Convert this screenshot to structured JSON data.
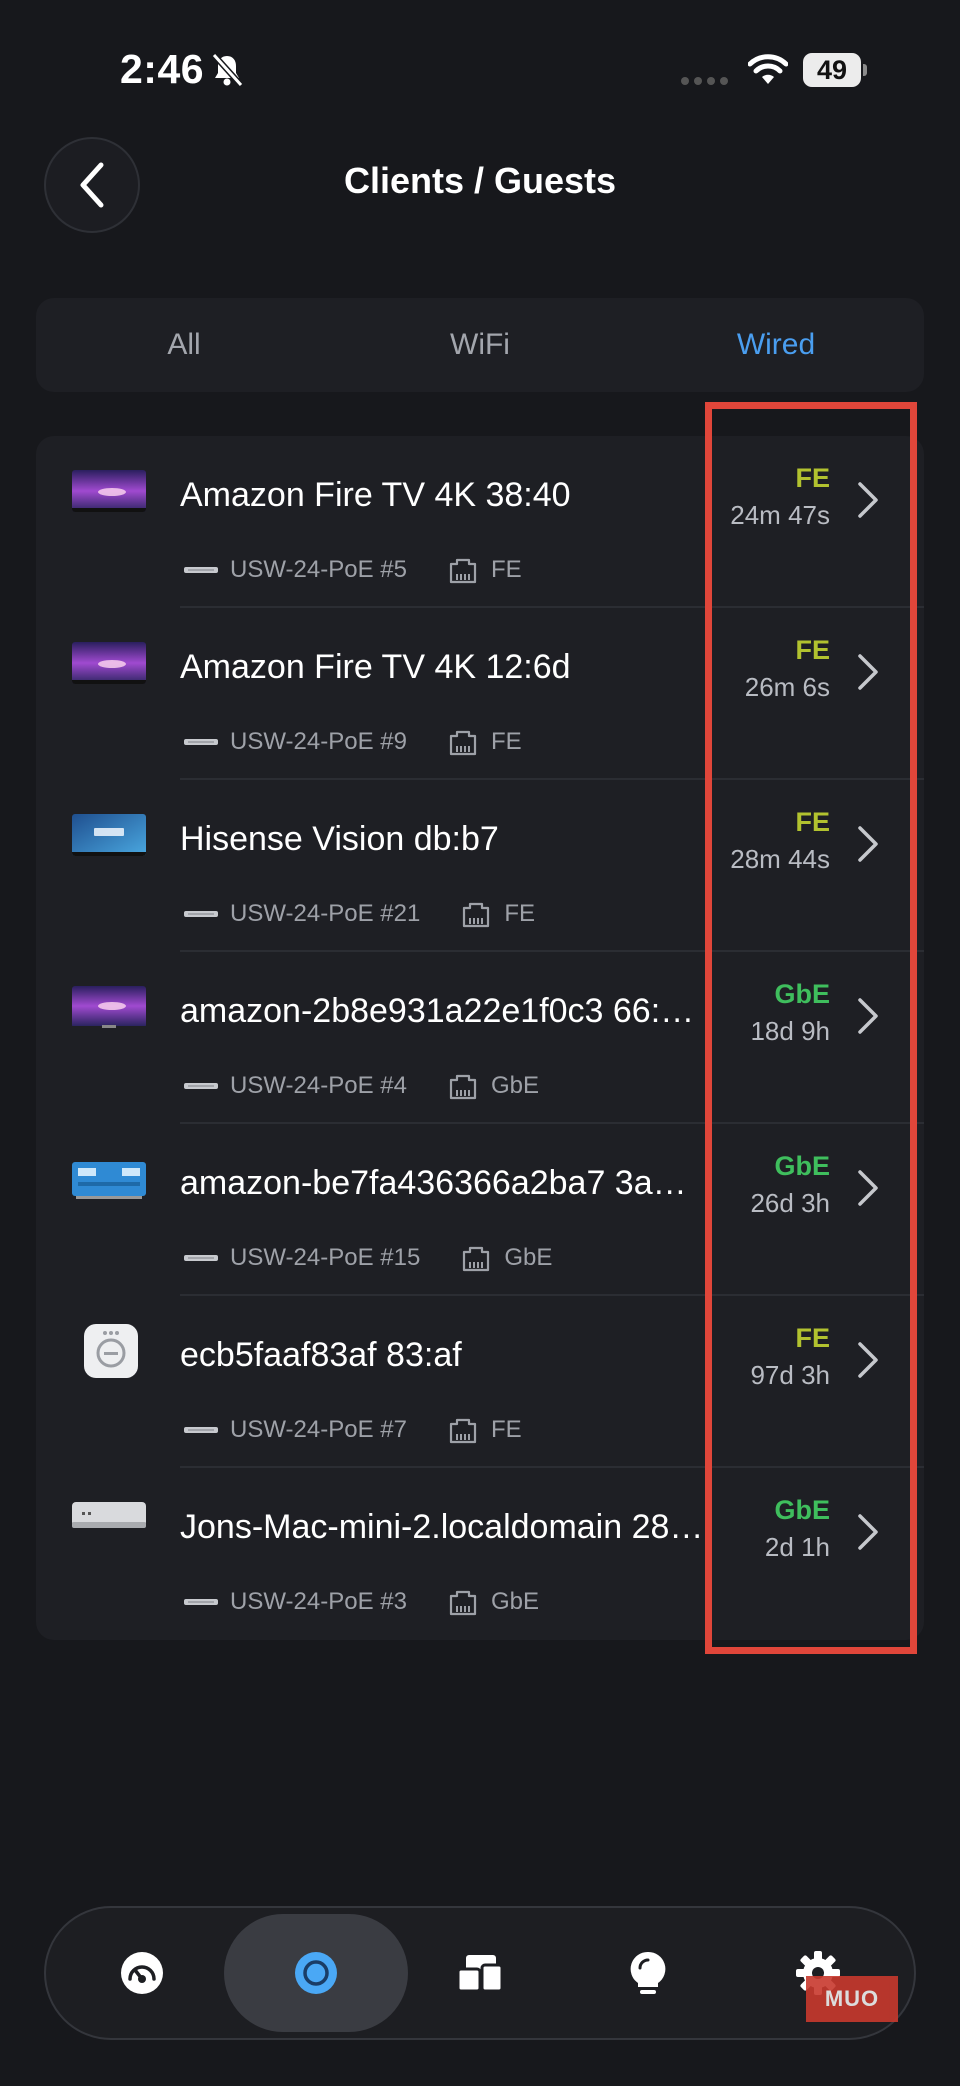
{
  "status_bar": {
    "time": "2:46",
    "battery": "49"
  },
  "header": {
    "title": "Clients / Guests"
  },
  "tabs": [
    {
      "label": "All",
      "active": false
    },
    {
      "label": "WiFi",
      "active": false
    },
    {
      "label": "Wired",
      "active": true
    }
  ],
  "clients": [
    {
      "name": "Amazon Fire TV 4K 38:40",
      "switch_port": "USW-24-PoE #5",
      "port_speed": "FE",
      "speed": "FE",
      "uptime": "24m 47s",
      "icon": "tv-purple-thumbnail"
    },
    {
      "name": "Amazon Fire TV 4K 12:6d",
      "switch_port": "USW-24-PoE #9",
      "port_speed": "FE",
      "speed": "FE",
      "uptime": "26m 6s",
      "icon": "tv-purple-thumbnail"
    },
    {
      "name": "Hisense Vision db:b7",
      "switch_port": "USW-24-PoE #21",
      "port_speed": "FE",
      "speed": "FE",
      "uptime": "28m 44s",
      "icon": "hisense-tv-thumbnail"
    },
    {
      "name": "amazon-2b8e931a22e1f0c3 66:…",
      "switch_port": "USW-24-PoE #4",
      "port_speed": "GbE",
      "speed": "GbE",
      "uptime": "18d 9h",
      "icon": "tv-purple-thumbnail"
    },
    {
      "name": "amazon-be7fa436366a2ba7 3a…",
      "switch_port": "USW-24-PoE #15",
      "port_speed": "GbE",
      "speed": "GbE",
      "uptime": "26d 3h",
      "icon": "blue-device-thumbnail"
    },
    {
      "name": "ecb5faaf83af 83:af",
      "switch_port": "USW-24-PoE #7",
      "port_speed": "FE",
      "speed": "FE",
      "uptime": "97d 3h",
      "icon": "hub-device-thumbnail"
    },
    {
      "name": "Jons-Mac-mini-2.localdomain 28…",
      "switch_port": "USW-24-PoE #3",
      "port_speed": "GbE",
      "speed": "GbE",
      "uptime": "2d 1h",
      "icon": "mac-mini-thumbnail"
    }
  ],
  "bottom_nav": [
    {
      "icon": "dashboard-icon",
      "active": false
    },
    {
      "icon": "topology-icon",
      "active": true
    },
    {
      "icon": "devices-icon",
      "active": false
    },
    {
      "icon": "insights-icon",
      "active": false
    },
    {
      "icon": "settings-icon",
      "active": false
    }
  ],
  "watermark": "MUO",
  "colors": {
    "background": "#17181c",
    "card": "#1e1f24",
    "accent": "#4a9ef0",
    "fe_speed": "#b2c22f",
    "gbe_speed": "#3fbe5d",
    "highlight": "#e0463a"
  }
}
